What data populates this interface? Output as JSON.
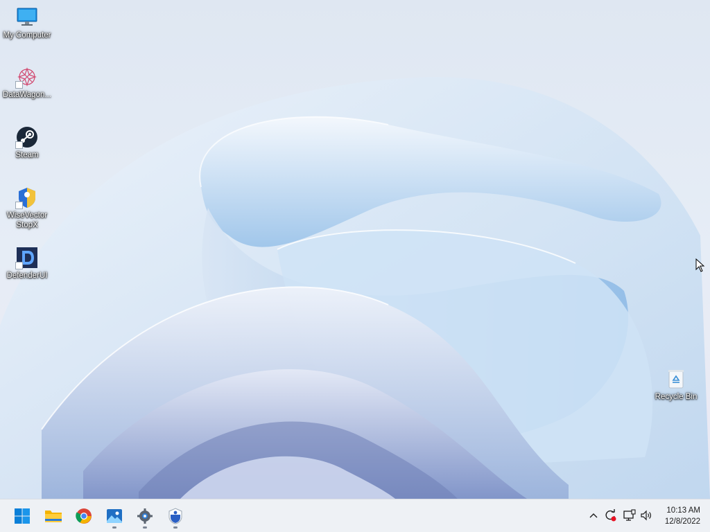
{
  "desktop": {
    "icons": [
      {
        "label": "My Computer",
        "icon": "monitor-icon"
      },
      {
        "label": "DataWagon...",
        "icon": "datawagon-icon"
      },
      {
        "label": "Steam",
        "icon": "steam-icon"
      },
      {
        "label": "WiseVector StopX",
        "icon": "wisevector-icon"
      },
      {
        "label": "DefenderUI",
        "icon": "defenderui-icon"
      },
      {
        "label": "Recycle Bin",
        "icon": "recycle-bin-icon"
      }
    ]
  },
  "taskbar": {
    "pinned": [
      {
        "name": "Start",
        "icon": "windows-start-icon"
      },
      {
        "name": "File Explorer",
        "icon": "folder-icon"
      },
      {
        "name": "Google Chrome",
        "icon": "chrome-icon"
      },
      {
        "name": "Photos",
        "icon": "photos-icon"
      },
      {
        "name": "Settings",
        "icon": "gear-icon"
      },
      {
        "name": "WiseVector StopX",
        "icon": "wisevector-icon"
      }
    ],
    "tray": {
      "icons": [
        "chevron-up-icon",
        "sync-alert-icon",
        "network-icon",
        "volume-icon"
      ]
    },
    "clock": {
      "time": "10:13 AM",
      "date": "12/8/2022"
    }
  },
  "colors": {
    "taskbar_bg": "#eef1f5",
    "wallpaper_base": "#dfe7f2",
    "accent_blue": "#0078d4"
  }
}
